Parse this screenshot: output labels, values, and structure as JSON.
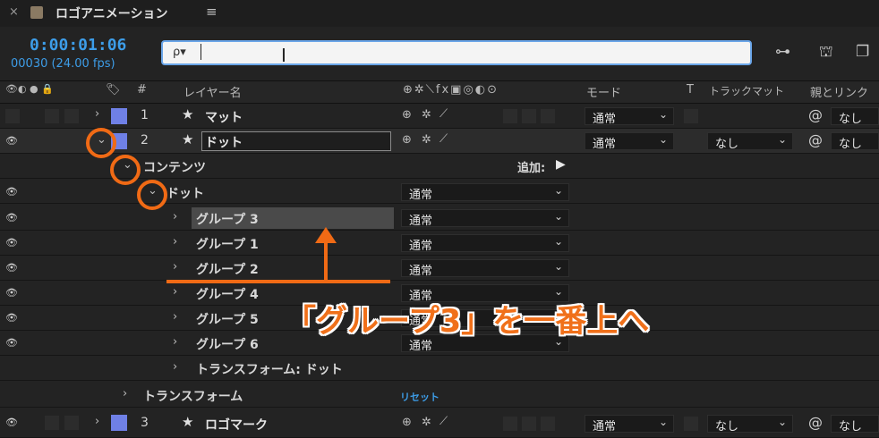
{
  "tab": {
    "close": "×",
    "title": "ロゴアニメーション",
    "menu": "≡"
  },
  "timecode": {
    "time": "0:00:01:06",
    "frames": "00030 (24.00 fps)"
  },
  "search": {
    "value": "",
    "icon": "ρ▾"
  },
  "columns": {
    "num": "#",
    "layer_name": "レイヤー名",
    "mode": "モード",
    "t": "T",
    "track_matte": "トラックマット",
    "parent": "親とリンク",
    "switches": "⊕✲⟍fx▣◎◐⊙"
  },
  "layers": [
    {
      "num": "1",
      "star": "★",
      "name": "マット",
      "mode": "通常",
      "parent": "なし",
      "matte": ""
    },
    {
      "num": "2",
      "star": "★",
      "name": "ドット",
      "mode": "通常",
      "parent": "なし",
      "matte": "なし"
    }
  ],
  "contents": {
    "label": "コンテンツ",
    "add": "追加:"
  },
  "dot_group": {
    "label": "ドット",
    "mode": "通常"
  },
  "groups": [
    {
      "name": "グループ 3",
      "mode": "通常"
    },
    {
      "name": "グループ 1",
      "mode": "通常"
    },
    {
      "name": "グループ 2",
      "mode": "通常"
    },
    {
      "name": "グループ 4",
      "mode": "通常"
    },
    {
      "name": "グループ 5",
      "mode": "通常"
    },
    {
      "name": "グループ 6",
      "mode": "通常"
    }
  ],
  "transform_dot": "トランスフォーム: ドット",
  "transform": {
    "label": "トランスフォーム",
    "reset": "リセット"
  },
  "layer3": {
    "num": "3",
    "star": "★",
    "name": "ロゴマーク",
    "mode": "通常",
    "matte": "なし",
    "parent": "なし"
  },
  "annotation": {
    "text": "「グループ3」を一番上へ"
  },
  "colors": {
    "accent": "#f06a15",
    "timecode": "#3d9de8",
    "label_blue": "#6f80e6"
  }
}
